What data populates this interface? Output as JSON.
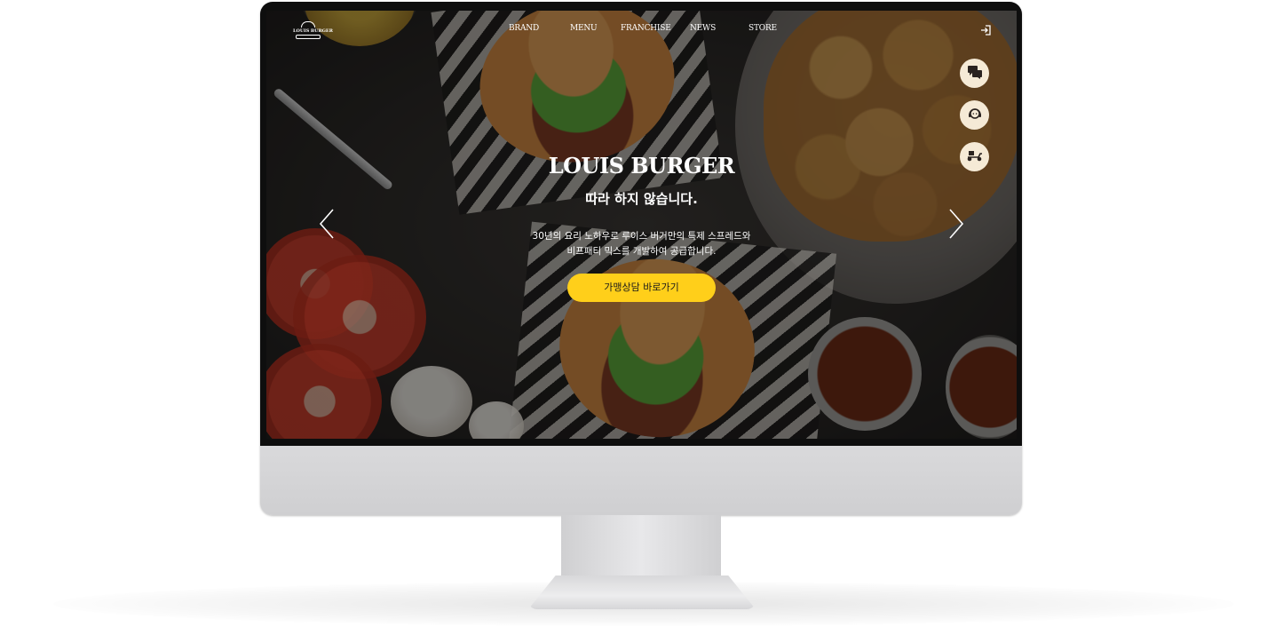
{
  "brand": {
    "logo_text": "LOUIS BURGER"
  },
  "nav": {
    "items": [
      {
        "label": "BRAND"
      },
      {
        "label": "MENU"
      },
      {
        "label": "FRANCHISE"
      },
      {
        "label": "NEWS"
      },
      {
        "label": "STORE"
      }
    ],
    "login_icon": "login-icon"
  },
  "quick_menu": [
    {
      "icon": "chat-icon"
    },
    {
      "icon": "support-agent-icon"
    },
    {
      "icon": "delivery-scooter-icon"
    }
  ],
  "hero": {
    "title": "LOUIS BURGER",
    "subtitle": "따라 하지 않습니다.",
    "description_line1": "30년의 요리 노하우로 루이스 버거만의 특제 스프레드와",
    "description_line2": "비프패티 믹스를 개발하여 공급합니다.",
    "cta_label": "가맹상담 바로가기",
    "prev_icon": "chevron-left-icon",
    "next_icon": "chevron-right-icon"
  },
  "colors": {
    "accent": "#ffcf1a",
    "quick_button_bg": "#f5ead6",
    "text": "#ffffff"
  }
}
